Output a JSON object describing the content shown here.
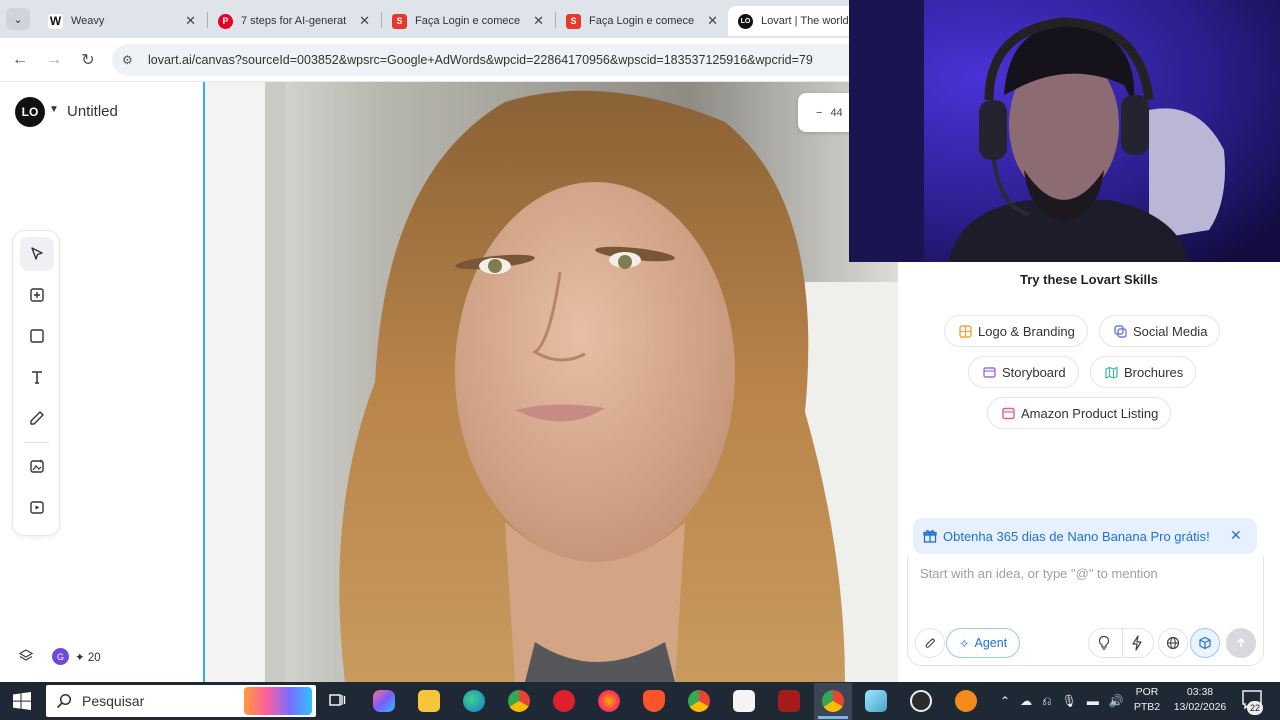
{
  "browser": {
    "tabs": [
      {
        "title": "Weavy",
        "icon": "weavy-w-icon",
        "active": false
      },
      {
        "title": "7 steps for AI-generat",
        "icon": "pinterest-icon",
        "active": false
      },
      {
        "title": "Faça Login e comece",
        "icon": "red-bag-icon",
        "active": false
      },
      {
        "title": "Faça Login e comece",
        "icon": "red-bag-icon",
        "active": false
      },
      {
        "title": "Lovart | The world",
        "icon": "lovart-icon",
        "active": true
      }
    ],
    "url": "lovart.ai/canvas?sourceId=003852&wpsrc=Google+AdWords&wpcid=22864170956&wpscid=183537125916&wpcrid=79"
  },
  "app": {
    "logo_text": "LO",
    "title": "Untitled",
    "zoom": "44",
    "zoom_minus": "−",
    "credits_avatar": "G",
    "credits": "20",
    "credits_icon": "lightning-icon"
  },
  "tools": [
    {
      "name": "select-tool",
      "icon": "cursor-arrow-icon"
    },
    {
      "name": "frame-tool",
      "icon": "add-frame-icon"
    },
    {
      "name": "shape-tool",
      "icon": "square-icon"
    },
    {
      "name": "text-tool",
      "icon": "text-t-icon"
    },
    {
      "name": "pen-tool",
      "icon": "pencil-icon"
    },
    {
      "name": "image-generator-tool",
      "icon": "image-sparkle-icon"
    },
    {
      "name": "video-generator-tool",
      "icon": "video-sparkle-icon"
    }
  ],
  "skills": {
    "title": "Try these Lovart Skills",
    "chips": [
      {
        "label": "Logo & Branding",
        "color": "#f0a53a"
      },
      {
        "label": "Social Media",
        "color": "#6b7be8"
      },
      {
        "label": "Storyboard",
        "color": "#9b6fe0"
      },
      {
        "label": "Brochures",
        "color": "#3fb8a8"
      },
      {
        "label": "Amazon Product Listing",
        "color": "#e0608e"
      }
    ]
  },
  "promo": {
    "text": "Obtenha 365 dias de Nano Banana Pro grátis!"
  },
  "chat": {
    "placeholder": "Start with an idea, or type \"@\" to mention",
    "agent_label": "Agent"
  },
  "taskbar": {
    "search_label": "Pesquisar",
    "lang_line1": "POR",
    "lang_line2": "PTB2",
    "time": "03:38",
    "date": "13/02/2026",
    "notifications": "22"
  },
  "colors": {
    "accent": "#1f6fd6",
    "selection": "#39a9ef",
    "taskbar": "#1f2936"
  }
}
